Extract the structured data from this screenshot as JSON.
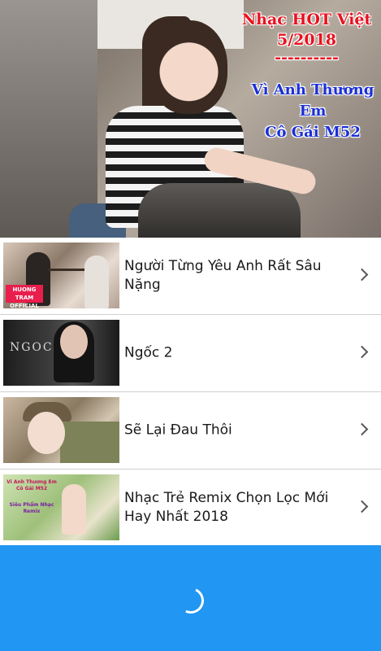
{
  "banner": {
    "title_line1": "Nhạc HOT Việt",
    "title_line2": "5/2018",
    "separator": "----------",
    "subtitle_line1": "Vì Anh Thương Em",
    "subtitle_line2": "Cô Gái M52"
  },
  "songs": [
    {
      "title": "Người Từng Yêu Anh Rất Sâu Nặng",
      "thumb_tag": "HUONG TRAM OFFICIAL"
    },
    {
      "title": "Ngốc 2",
      "thumb_logo": "NGOC 2"
    },
    {
      "title": "Sẽ Lại Đau Thôi"
    },
    {
      "title": "Nhạc Trẻ Remix Chọn Lọc Mới Hay Nhất 2018",
      "thumb_text1": "Vì Anh Thương Em Cô Gái M52",
      "thumb_text2": "Siêu Phẩm Nhạc Remix"
    }
  ],
  "loading": {
    "color": "#2196f3"
  },
  "colors": {
    "banner_title": "#e8121f",
    "banner_subtitle": "#1a2fd6"
  },
  "icons": {
    "row_arrow": "chevron-right-icon",
    "loader": "spinner-icon"
  }
}
